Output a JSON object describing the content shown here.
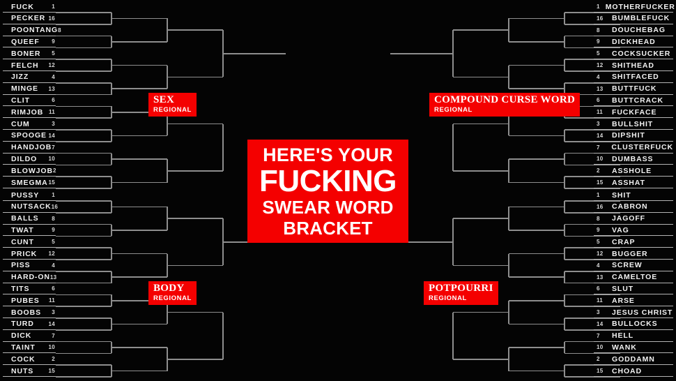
{
  "title": {
    "line1": "HERE'S YOUR",
    "line2": "FUCKING",
    "line3": "SWEAR WORD",
    "line4": "BRACKET"
  },
  "colors": {
    "background": "#040404",
    "accent_red": "#f40000",
    "line_gray": "#8e8e8e",
    "text_white": "#f2f2f2"
  },
  "regions": [
    {
      "id": "sex",
      "name": "SEX",
      "sub": "REGIONAL",
      "position": "top-left"
    },
    {
      "id": "body",
      "name": "BODY",
      "sub": "REGIONAL",
      "position": "bottom-left"
    },
    {
      "id": "compound",
      "name": "COMPOUND CURSE WORD",
      "sub": "REGIONAL",
      "position": "top-right"
    },
    {
      "id": "potpourri",
      "name": "POTPOURRI",
      "sub": "REGIONAL",
      "position": "bottom-right"
    }
  ],
  "brackets": {
    "sex": [
      {
        "seed": "1",
        "name": "FUCK"
      },
      {
        "seed": "16",
        "name": "PECKER"
      },
      {
        "seed": "8",
        "name": "POONTANG"
      },
      {
        "seed": "9",
        "name": "QUEEF"
      },
      {
        "seed": "5",
        "name": "BONER"
      },
      {
        "seed": "12",
        "name": "FELCH"
      },
      {
        "seed": "4",
        "name": "JIZZ"
      },
      {
        "seed": "13",
        "name": "MINGE"
      },
      {
        "seed": "6",
        "name": "CLIT"
      },
      {
        "seed": "11",
        "name": "RIMJOB"
      },
      {
        "seed": "3",
        "name": "CUM"
      },
      {
        "seed": "14",
        "name": "SPOOGE"
      },
      {
        "seed": "7",
        "name": "HANDJOB"
      },
      {
        "seed": "10",
        "name": "DILDO"
      },
      {
        "seed": "2",
        "name": "BLOWJOB"
      },
      {
        "seed": "15",
        "name": "SMEGMA"
      }
    ],
    "body": [
      {
        "seed": "1",
        "name": "PUSSY"
      },
      {
        "seed": "16",
        "name": "NUTSACK"
      },
      {
        "seed": "8",
        "name": "BALLS"
      },
      {
        "seed": "9",
        "name": "TWAT"
      },
      {
        "seed": "5",
        "name": "CUNT"
      },
      {
        "seed": "12",
        "name": "PRICK"
      },
      {
        "seed": "4",
        "name": "PISS"
      },
      {
        "seed": "13",
        "name": "HARD-ON"
      },
      {
        "seed": "6",
        "name": "TITS"
      },
      {
        "seed": "11",
        "name": "PUBES"
      },
      {
        "seed": "3",
        "name": "BOOBS"
      },
      {
        "seed": "14",
        "name": "TURD"
      },
      {
        "seed": "7",
        "name": "DICK"
      },
      {
        "seed": "10",
        "name": "TAINT"
      },
      {
        "seed": "2",
        "name": "COCK"
      },
      {
        "seed": "15",
        "name": "NUTS"
      }
    ],
    "compound": [
      {
        "seed": "1",
        "name": "MOTHERFUCKER"
      },
      {
        "seed": "16",
        "name": "BUMBLEFUCK"
      },
      {
        "seed": "8",
        "name": "DOUCHEBAG"
      },
      {
        "seed": "9",
        "name": "DICKHEAD"
      },
      {
        "seed": "5",
        "name": "COCKSUCKER"
      },
      {
        "seed": "12",
        "name": "SHITHEAD"
      },
      {
        "seed": "4",
        "name": "SHITFACED"
      },
      {
        "seed": "13",
        "name": "BUTTFUCK"
      },
      {
        "seed": "6",
        "name": "BUTTCRACK"
      },
      {
        "seed": "11",
        "name": "FUCKFACE"
      },
      {
        "seed": "3",
        "name": "BULLSHIT"
      },
      {
        "seed": "14",
        "name": "DIPSHIT"
      },
      {
        "seed": "7",
        "name": "CLUSTERFUCK"
      },
      {
        "seed": "10",
        "name": "DUMBASS"
      },
      {
        "seed": "2",
        "name": "ASSHOLE"
      },
      {
        "seed": "15",
        "name": "ASSHAT"
      }
    ],
    "potpourri": [
      {
        "seed": "1",
        "name": "SHIT"
      },
      {
        "seed": "16",
        "name": "CABRON"
      },
      {
        "seed": "8",
        "name": "JAGOFF"
      },
      {
        "seed": "9",
        "name": "VAG"
      },
      {
        "seed": "5",
        "name": "CRAP"
      },
      {
        "seed": "12",
        "name": "BUGGER"
      },
      {
        "seed": "4",
        "name": "SCREW"
      },
      {
        "seed": "13",
        "name": "CAMELTOE"
      },
      {
        "seed": "6",
        "name": "SLUT"
      },
      {
        "seed": "11",
        "name": "ARSE"
      },
      {
        "seed": "3",
        "name": "JESUS CHRIST"
      },
      {
        "seed": "14",
        "name": "BULLOCKS"
      },
      {
        "seed": "7",
        "name": "HELL"
      },
      {
        "seed": "10",
        "name": "WANK"
      },
      {
        "seed": "2",
        "name": "GODDAMN"
      },
      {
        "seed": "15",
        "name": "CHOAD"
      }
    ]
  }
}
